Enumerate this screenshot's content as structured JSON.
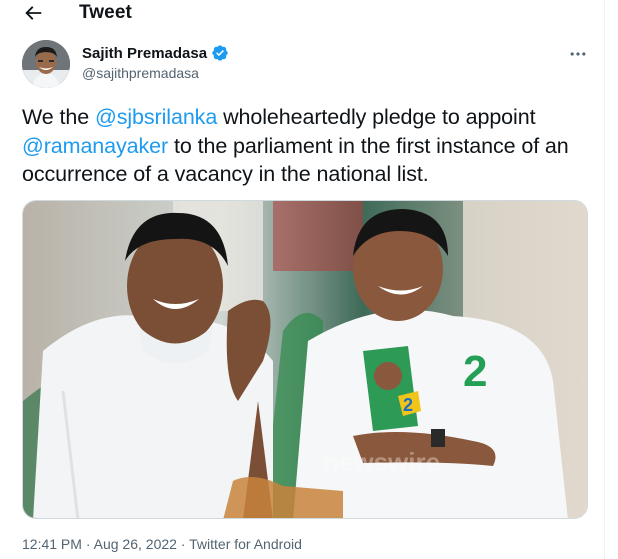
{
  "header": {
    "title": "Tweet",
    "back_icon": "arrow-left-icon"
  },
  "author": {
    "display_name": "Sajith Premadasa",
    "handle": "@sajithpremadasa",
    "verified_icon": "verified-badge-icon",
    "more_icon": "more-horizontal-icon"
  },
  "tweet": {
    "text_1": "We the ",
    "mention_1": "@sjbsrilanka",
    "text_2": " wholeheartedly pledge to appoint ",
    "mention_2": "@ramanayaker",
    "text_3": " to the parliament in the first instance of an occurrence of a vacancy in the national list."
  },
  "media": {
    "sticker_number": "2",
    "watermark": "newswire"
  },
  "meta": {
    "time": "12:41 PM",
    "separator": "·",
    "date": "Aug 26, 2022",
    "source": "Twitter for Android"
  },
  "colors": {
    "accent": "#1d9bf0",
    "text": "#0f1419",
    "secondary": "#536471"
  }
}
